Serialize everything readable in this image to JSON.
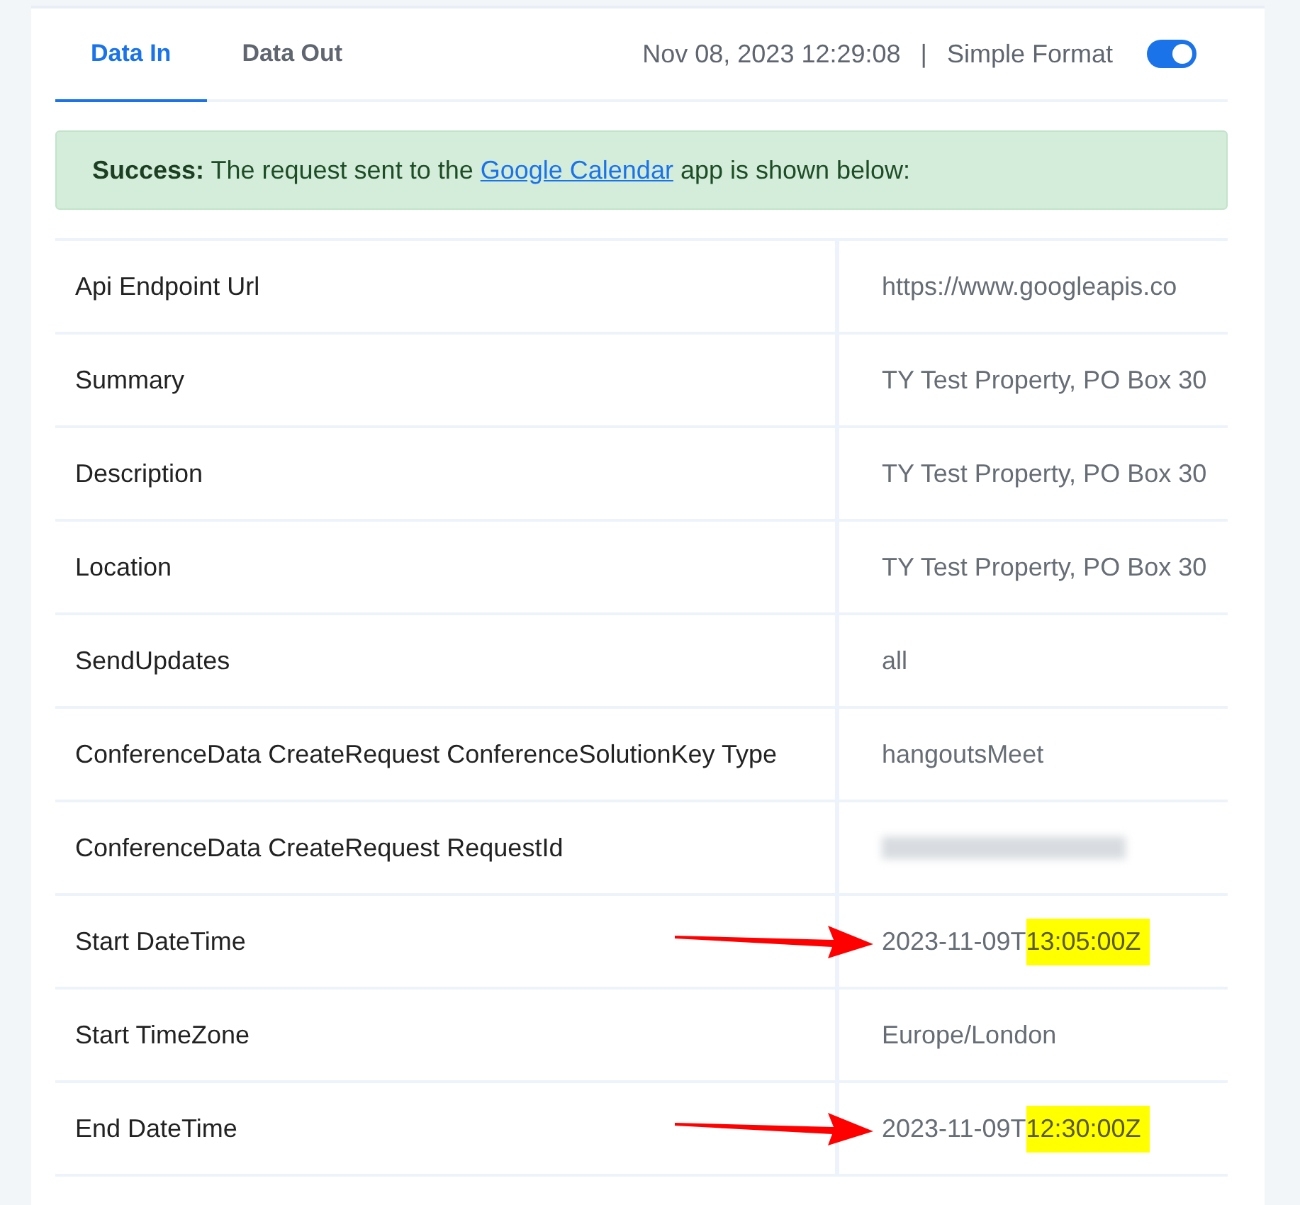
{
  "tabs": [
    {
      "label": "Data In",
      "selected": true
    },
    {
      "label": "Data Out",
      "selected": false
    }
  ],
  "timestamp": "Nov 08, 2023 12:29:08",
  "separator": "|",
  "format_toggle": {
    "label": "Simple Format",
    "on": true
  },
  "banner": {
    "lead": "Success:",
    "before": "The request sent to the",
    "link": "Google Calendar",
    "after": "app is shown below:"
  },
  "rows": [
    {
      "kind": "text",
      "label": "Api Endpoint Url",
      "value": "https://www.googleapis.co"
    },
    {
      "kind": "text",
      "label": "Summary",
      "value": "TY Test Property, PO Box 30"
    },
    {
      "kind": "text",
      "label": "Description",
      "value": "TY Test Property, PO Box 30"
    },
    {
      "kind": "text",
      "label": "Location",
      "value": "TY Test Property, PO Box 30"
    },
    {
      "kind": "text",
      "label": "SendUpdates",
      "value": "all"
    },
    {
      "kind": "text",
      "label": "ConferenceData CreateRequest ConferenceSolutionKey Type",
      "value": "hangoutsMeet"
    },
    {
      "kind": "redacted",
      "label": "ConferenceData CreateRequest RequestId"
    },
    {
      "kind": "highlight",
      "label": "Start DateTime",
      "value": "2023-11-09T",
      "highlight": "13:05:00Z",
      "arrow": true
    },
    {
      "kind": "text",
      "label": "Start TimeZone",
      "value": "Europe/London"
    },
    {
      "kind": "highlight",
      "label": "End DateTime",
      "value": "2023-11-09T",
      "highlight": "12:30:00Z",
      "arrow": true
    }
  ]
}
